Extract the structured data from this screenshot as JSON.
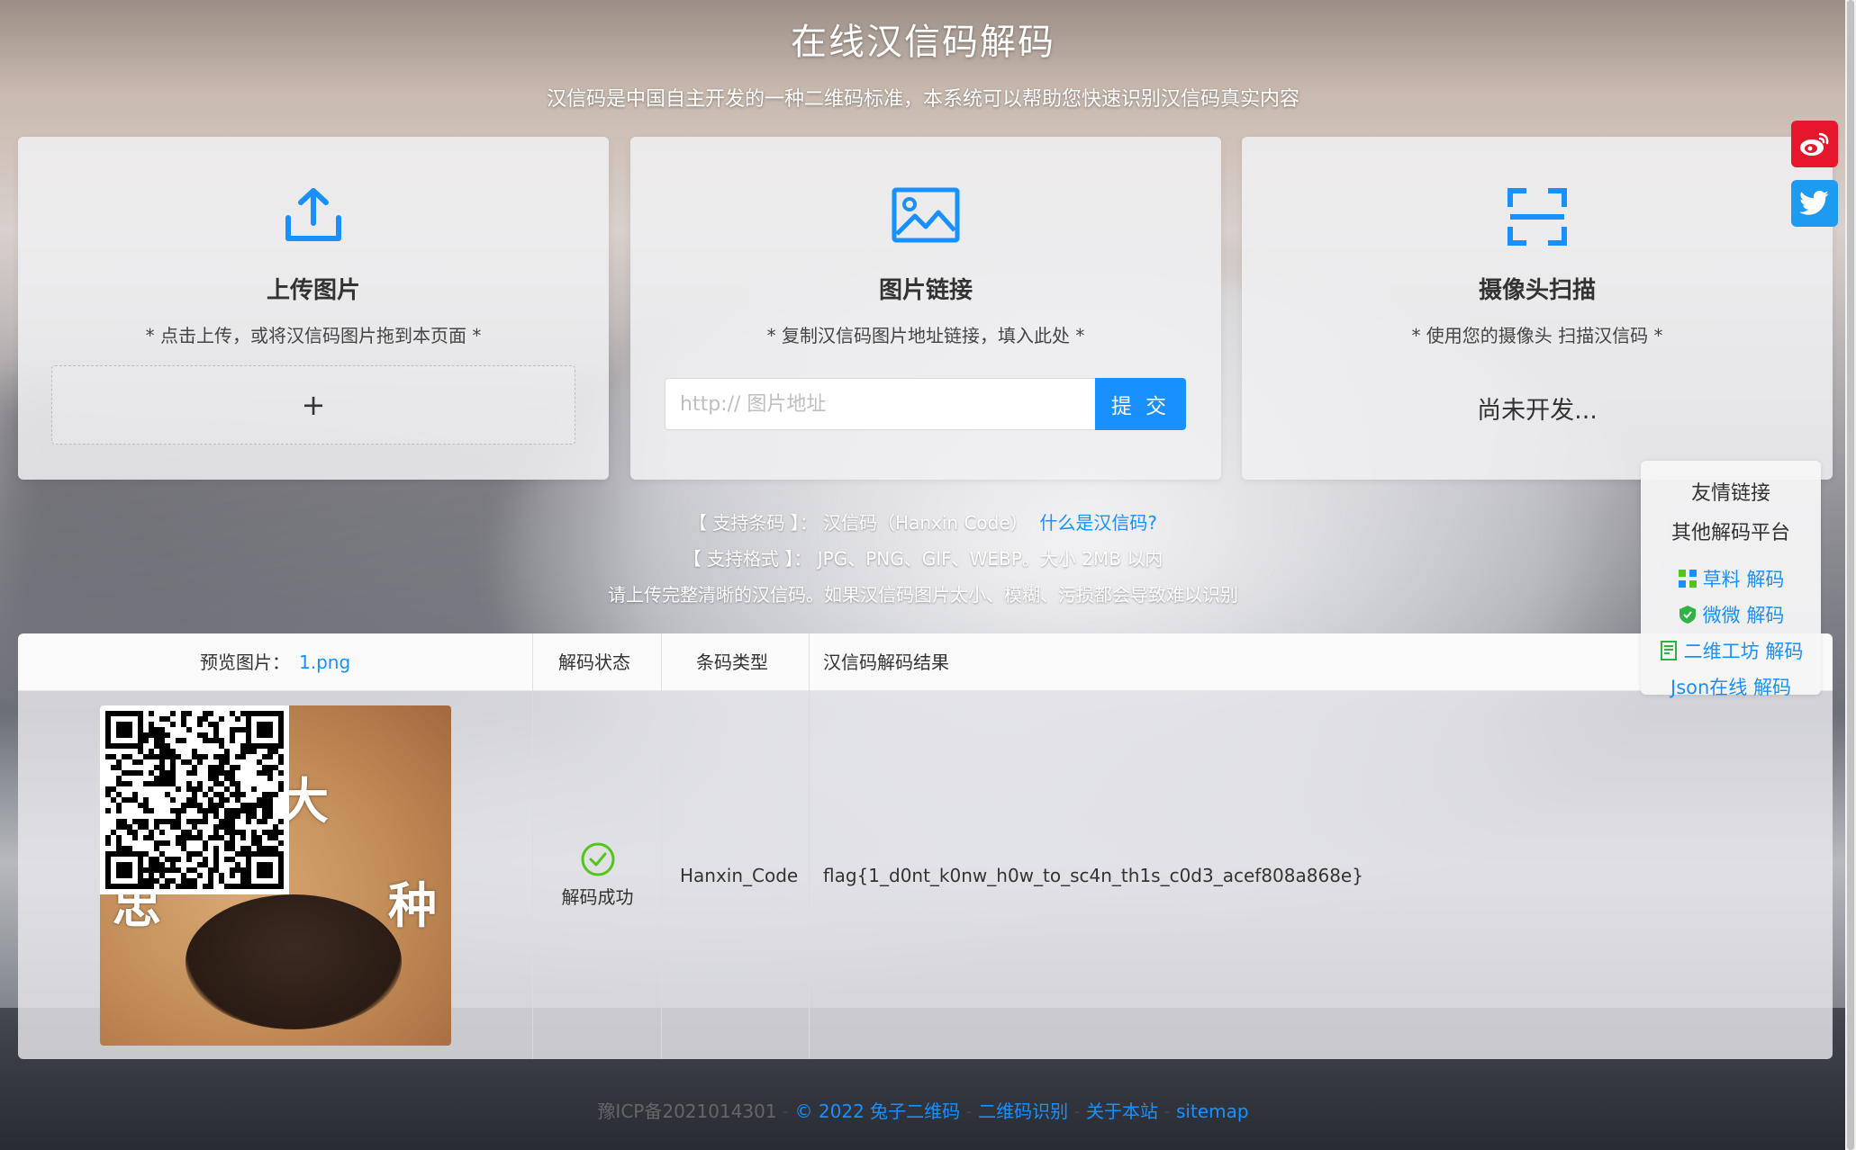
{
  "header": {
    "title": "在线汉信码解码",
    "subtitle": "汉信码是中国自主开发的一种二维码标准，本系统可以帮助您快速识别汉信码真实内容"
  },
  "cards": {
    "upload": {
      "title": "上传图片",
      "desc": "* 点击上传，或将汉信码图片拖到本页面 *",
      "plus": "+",
      "icon": "upload-icon"
    },
    "url": {
      "title": "图片链接",
      "desc": "* 复制汉信码图片地址链接，填入此处 *",
      "placeholder": "http:// 图片地址",
      "submit_label": "提 交",
      "icon": "image-icon"
    },
    "camera": {
      "title": "摄像头扫描",
      "desc": "* 使用您的摄像头 扫描汉信码 *",
      "status": "尚未开发...",
      "icon": "scan-icon"
    }
  },
  "info": {
    "support_code_label": "【 支持条码 】：",
    "support_code_value": "汉信码（Hanxin Code）",
    "what_is_link": "什么是汉信码?",
    "support_format_label": "【 支持格式 】：",
    "support_format_value": "JPG、PNG、GIF、WEBP。大小 2MB 以内",
    "notice": "请上传完整清晰的汉信码。如果汉信码图片太小、模糊、污损都会导致难以识别"
  },
  "table": {
    "headers": {
      "preview_label": "预览图片：",
      "preview_file": "1.png",
      "status": "解码状态",
      "type": "条码类型",
      "result": "汉信码解码结果"
    },
    "row": {
      "image_text_1": "大",
      "image_text_2": "种",
      "image_text_3": "忠",
      "status": "解码成功",
      "type": "Hanxin_Code",
      "result": "flag{1_d0nt_k0nw_h0w_to_sc4n_th1s_c0d3_acef808a868e}"
    }
  },
  "social": [
    {
      "icon": "weibo-icon",
      "color": "#e6162d"
    },
    {
      "icon": "twitter-icon",
      "color": "#1d9bf0"
    }
  ],
  "friend_links": {
    "title": "友情链接",
    "subtitle": "其他解码平台",
    "items": [
      {
        "label": "草料 解码",
        "icon": "qr-grid-icon"
      },
      {
        "label": "微微 解码",
        "icon": "shield-icon"
      },
      {
        "label": "二维工坊 解码",
        "icon": "document-icon"
      },
      {
        "label": "Json在线 解码",
        "icon": ""
      }
    ]
  },
  "footer": {
    "icp": "豫ICP备2021014301",
    "copyright": "© 2022 兔子二维码",
    "link_1": "二维码识别",
    "link_2": "关于本站",
    "link_3": "sitemap",
    "sep": "-"
  }
}
